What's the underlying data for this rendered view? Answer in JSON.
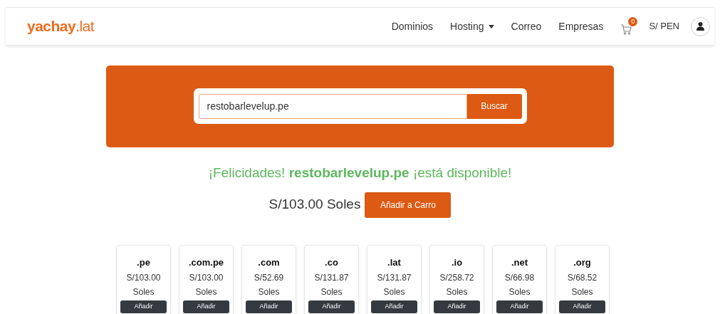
{
  "header": {
    "logo": {
      "name": "yachay",
      "suffix": ".lat"
    },
    "nav": [
      {
        "label": "Dominios",
        "kind": "link"
      },
      {
        "label": "Hosting",
        "kind": "dropdown"
      },
      {
        "label": "Correo",
        "kind": "link"
      },
      {
        "label": "Empresas",
        "kind": "link"
      }
    ],
    "cart_count": "0",
    "currency": "S/ PEN"
  },
  "search": {
    "value": "restobarlevelup.pe",
    "button": "Buscar"
  },
  "result": {
    "message": "¡Felicidades! **restobarlevelup.pe** ¡está disponible!",
    "price": "S/103.00 Soles",
    "button": "Añadir a Carro"
  },
  "extensions": [
    {
      "tld": ".pe",
      "price": "S/103.00",
      "unit": "Soles",
      "button": "Añadir"
    },
    {
      "tld": ".com.pe",
      "price": "S/103.00",
      "unit": "Soles",
      "button": "Añadir"
    },
    {
      "tld": ".com",
      "price": "S/52.69",
      "unit": "Soles",
      "button": "Añadir"
    },
    {
      "tld": ".co",
      "price": "S/131.87",
      "unit": "Soles",
      "button": "Añadir"
    },
    {
      "tld": ".lat",
      "price": "S/131.87",
      "unit": "Soles",
      "button": "Añadir"
    },
    {
      "tld": ".io",
      "price": "S/258.72",
      "unit": "Soles",
      "button": "Añadir"
    },
    {
      "tld": ".net",
      "price": "S/66.98",
      "unit": "Soles",
      "button": "Añadir"
    },
    {
      "tld": ".org",
      "price": "S/68.52",
      "unit": "Soles",
      "button": "Añadir"
    }
  ]
}
